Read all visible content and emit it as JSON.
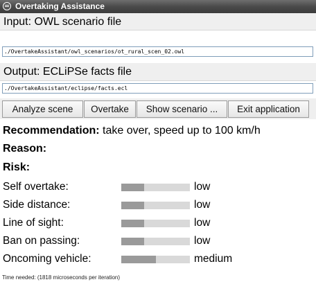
{
  "window": {
    "title": "Overtaking Assistance"
  },
  "input": {
    "heading": "Input: OWL scenario file",
    "path": "./OvertakeAssistant/owl_scenarios/ot_rural_scen_02.owl"
  },
  "output": {
    "heading": "Output: ECLiPSe facts file",
    "path": "./OvertakeAssistant/eclipse/facts.ecl"
  },
  "toolbar": {
    "analyze": "Analyze scene",
    "overtake": "Overtake",
    "show": "Show scenario ...",
    "exit": "Exit application"
  },
  "recommendation": {
    "label": "Recommendation:",
    "text": "take over, speed up to 100 km/h"
  },
  "reason": {
    "label": "Reason:",
    "text": ""
  },
  "risk": {
    "label": "Risk:",
    "items": [
      {
        "label": "Self overtake:",
        "value": "low",
        "level": 0.33
      },
      {
        "label": "Side distance:",
        "value": "low",
        "level": 0.33
      },
      {
        "label": "Line of sight:",
        "value": "low",
        "level": 0.33
      },
      {
        "label": "Ban on passing:",
        "value": "low",
        "level": 0.33
      },
      {
        "label": "Oncoming vehicle:",
        "value": "medium",
        "level": 0.5
      }
    ]
  },
  "status": "Time needed: (1818 microseconds per iteration)",
  "colors": {
    "titlebar": "#4a4a4a",
    "bar_bg": "#d9d9d9",
    "bar_fill": "#9a9a9a"
  }
}
